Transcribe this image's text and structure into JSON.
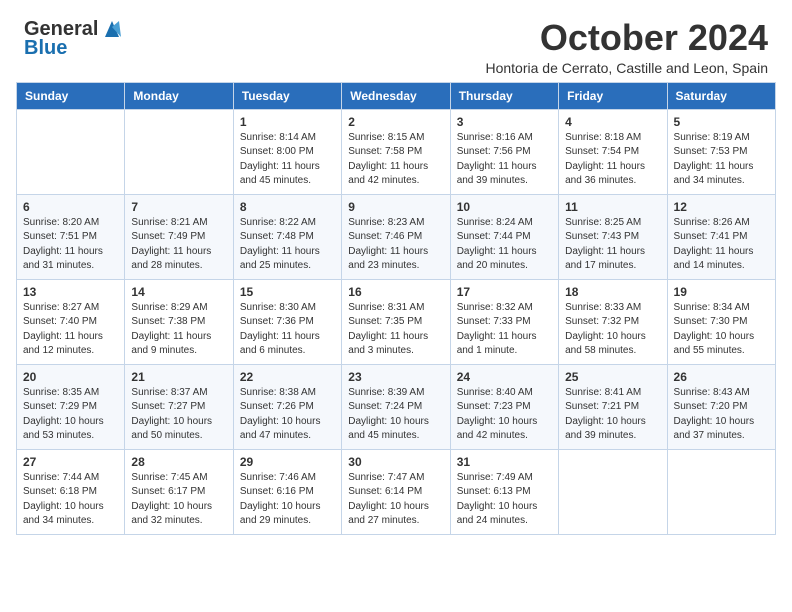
{
  "header": {
    "logo_general": "General",
    "logo_blue": "Blue",
    "month_title": "October 2024",
    "subtitle": "Hontoria de Cerrato, Castille and Leon, Spain"
  },
  "days_of_week": [
    "Sunday",
    "Monday",
    "Tuesday",
    "Wednesday",
    "Thursday",
    "Friday",
    "Saturday"
  ],
  "weeks": [
    [
      {
        "day": "",
        "sunrise": "",
        "sunset": "",
        "daylight": ""
      },
      {
        "day": "",
        "sunrise": "",
        "sunset": "",
        "daylight": ""
      },
      {
        "day": "1",
        "sunrise": "Sunrise: 8:14 AM",
        "sunset": "Sunset: 8:00 PM",
        "daylight": "Daylight: 11 hours and 45 minutes."
      },
      {
        "day": "2",
        "sunrise": "Sunrise: 8:15 AM",
        "sunset": "Sunset: 7:58 PM",
        "daylight": "Daylight: 11 hours and 42 minutes."
      },
      {
        "day": "3",
        "sunrise": "Sunrise: 8:16 AM",
        "sunset": "Sunset: 7:56 PM",
        "daylight": "Daylight: 11 hours and 39 minutes."
      },
      {
        "day": "4",
        "sunrise": "Sunrise: 8:18 AM",
        "sunset": "Sunset: 7:54 PM",
        "daylight": "Daylight: 11 hours and 36 minutes."
      },
      {
        "day": "5",
        "sunrise": "Sunrise: 8:19 AM",
        "sunset": "Sunset: 7:53 PM",
        "daylight": "Daylight: 11 hours and 34 minutes."
      }
    ],
    [
      {
        "day": "6",
        "sunrise": "Sunrise: 8:20 AM",
        "sunset": "Sunset: 7:51 PM",
        "daylight": "Daylight: 11 hours and 31 minutes."
      },
      {
        "day": "7",
        "sunrise": "Sunrise: 8:21 AM",
        "sunset": "Sunset: 7:49 PM",
        "daylight": "Daylight: 11 hours and 28 minutes."
      },
      {
        "day": "8",
        "sunrise": "Sunrise: 8:22 AM",
        "sunset": "Sunset: 7:48 PM",
        "daylight": "Daylight: 11 hours and 25 minutes."
      },
      {
        "day": "9",
        "sunrise": "Sunrise: 8:23 AM",
        "sunset": "Sunset: 7:46 PM",
        "daylight": "Daylight: 11 hours and 23 minutes."
      },
      {
        "day": "10",
        "sunrise": "Sunrise: 8:24 AM",
        "sunset": "Sunset: 7:44 PM",
        "daylight": "Daylight: 11 hours and 20 minutes."
      },
      {
        "day": "11",
        "sunrise": "Sunrise: 8:25 AM",
        "sunset": "Sunset: 7:43 PM",
        "daylight": "Daylight: 11 hours and 17 minutes."
      },
      {
        "day": "12",
        "sunrise": "Sunrise: 8:26 AM",
        "sunset": "Sunset: 7:41 PM",
        "daylight": "Daylight: 11 hours and 14 minutes."
      }
    ],
    [
      {
        "day": "13",
        "sunrise": "Sunrise: 8:27 AM",
        "sunset": "Sunset: 7:40 PM",
        "daylight": "Daylight: 11 hours and 12 minutes."
      },
      {
        "day": "14",
        "sunrise": "Sunrise: 8:29 AM",
        "sunset": "Sunset: 7:38 PM",
        "daylight": "Daylight: 11 hours and 9 minutes."
      },
      {
        "day": "15",
        "sunrise": "Sunrise: 8:30 AM",
        "sunset": "Sunset: 7:36 PM",
        "daylight": "Daylight: 11 hours and 6 minutes."
      },
      {
        "day": "16",
        "sunrise": "Sunrise: 8:31 AM",
        "sunset": "Sunset: 7:35 PM",
        "daylight": "Daylight: 11 hours and 3 minutes."
      },
      {
        "day": "17",
        "sunrise": "Sunrise: 8:32 AM",
        "sunset": "Sunset: 7:33 PM",
        "daylight": "Daylight: 11 hours and 1 minute."
      },
      {
        "day": "18",
        "sunrise": "Sunrise: 8:33 AM",
        "sunset": "Sunset: 7:32 PM",
        "daylight": "Daylight: 10 hours and 58 minutes."
      },
      {
        "day": "19",
        "sunrise": "Sunrise: 8:34 AM",
        "sunset": "Sunset: 7:30 PM",
        "daylight": "Daylight: 10 hours and 55 minutes."
      }
    ],
    [
      {
        "day": "20",
        "sunrise": "Sunrise: 8:35 AM",
        "sunset": "Sunset: 7:29 PM",
        "daylight": "Daylight: 10 hours and 53 minutes."
      },
      {
        "day": "21",
        "sunrise": "Sunrise: 8:37 AM",
        "sunset": "Sunset: 7:27 PM",
        "daylight": "Daylight: 10 hours and 50 minutes."
      },
      {
        "day": "22",
        "sunrise": "Sunrise: 8:38 AM",
        "sunset": "Sunset: 7:26 PM",
        "daylight": "Daylight: 10 hours and 47 minutes."
      },
      {
        "day": "23",
        "sunrise": "Sunrise: 8:39 AM",
        "sunset": "Sunset: 7:24 PM",
        "daylight": "Daylight: 10 hours and 45 minutes."
      },
      {
        "day": "24",
        "sunrise": "Sunrise: 8:40 AM",
        "sunset": "Sunset: 7:23 PM",
        "daylight": "Daylight: 10 hours and 42 minutes."
      },
      {
        "day": "25",
        "sunrise": "Sunrise: 8:41 AM",
        "sunset": "Sunset: 7:21 PM",
        "daylight": "Daylight: 10 hours and 39 minutes."
      },
      {
        "day": "26",
        "sunrise": "Sunrise: 8:43 AM",
        "sunset": "Sunset: 7:20 PM",
        "daylight": "Daylight: 10 hours and 37 minutes."
      }
    ],
    [
      {
        "day": "27",
        "sunrise": "Sunrise: 7:44 AM",
        "sunset": "Sunset: 6:18 PM",
        "daylight": "Daylight: 10 hours and 34 minutes."
      },
      {
        "day": "28",
        "sunrise": "Sunrise: 7:45 AM",
        "sunset": "Sunset: 6:17 PM",
        "daylight": "Daylight: 10 hours and 32 minutes."
      },
      {
        "day": "29",
        "sunrise": "Sunrise: 7:46 AM",
        "sunset": "Sunset: 6:16 PM",
        "daylight": "Daylight: 10 hours and 29 minutes."
      },
      {
        "day": "30",
        "sunrise": "Sunrise: 7:47 AM",
        "sunset": "Sunset: 6:14 PM",
        "daylight": "Daylight: 10 hours and 27 minutes."
      },
      {
        "day": "31",
        "sunrise": "Sunrise: 7:49 AM",
        "sunset": "Sunset: 6:13 PM",
        "daylight": "Daylight: 10 hours and 24 minutes."
      },
      {
        "day": "",
        "sunrise": "",
        "sunset": "",
        "daylight": ""
      },
      {
        "day": "",
        "sunrise": "",
        "sunset": "",
        "daylight": ""
      }
    ]
  ]
}
